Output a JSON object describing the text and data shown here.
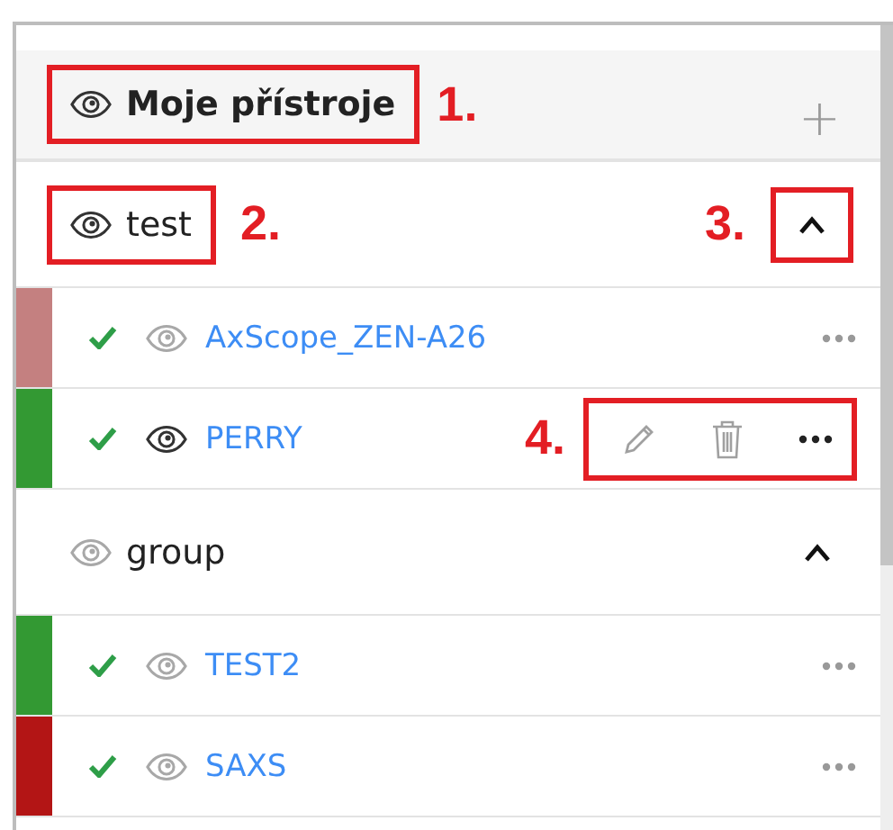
{
  "header": {
    "title": "Moje přístroje",
    "eye_dark": true,
    "annotation": "1.",
    "add_label": "+"
  },
  "groups": [
    {
      "name": "test",
      "eye_dark": true,
      "expanded": true,
      "name_annotation": "2.",
      "toggle_annotation": "3.",
      "devices": [
        {
          "name": "AxScope_ZEN-A26",
          "color": "#c48080",
          "checked": true,
          "eye_dark": false,
          "show_actions": false
        },
        {
          "name": "PERRY",
          "color": "#339933",
          "checked": true,
          "eye_dark": true,
          "show_actions": true,
          "actions_annotation": "4."
        }
      ]
    },
    {
      "name": "group",
      "eye_dark": false,
      "expanded": true,
      "devices": [
        {
          "name": "TEST2",
          "color": "#339933",
          "checked": true,
          "eye_dark": false,
          "show_actions": false
        },
        {
          "name": "SAXS",
          "color": "#b31515",
          "checked": true,
          "eye_dark": false,
          "show_actions": false
        }
      ]
    }
  ]
}
